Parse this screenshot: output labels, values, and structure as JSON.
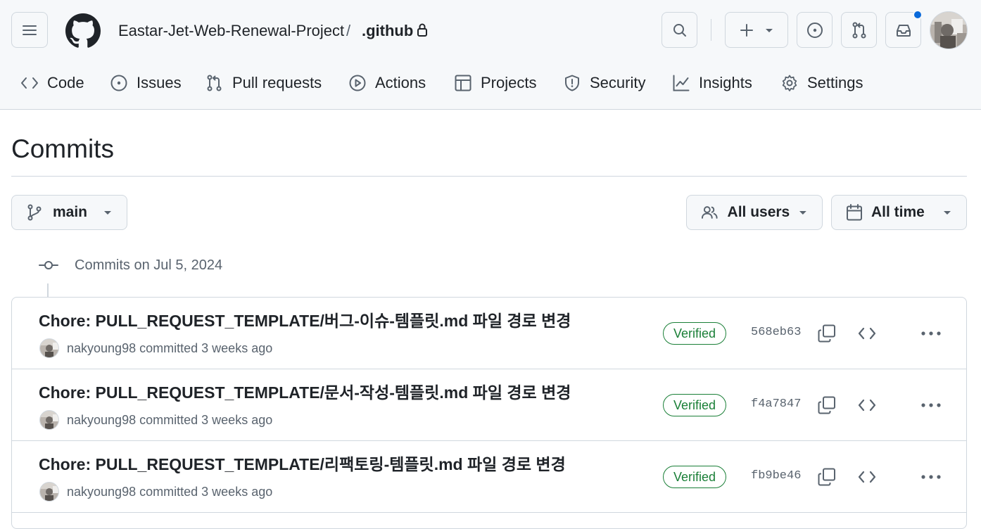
{
  "header": {
    "owner": "Eastar-Jet-Web-Renewal-Project",
    "separator": "/",
    "repo": ".github"
  },
  "repo_nav": [
    {
      "label": "Code",
      "icon": "code-icon"
    },
    {
      "label": "Issues",
      "icon": "issue-opened-icon"
    },
    {
      "label": "Pull requests",
      "icon": "git-pull-request-icon"
    },
    {
      "label": "Actions",
      "icon": "play-icon"
    },
    {
      "label": "Projects",
      "icon": "table-icon"
    },
    {
      "label": "Security",
      "icon": "shield-icon"
    },
    {
      "label": "Insights",
      "icon": "graph-icon"
    },
    {
      "label": "Settings",
      "icon": "gear-icon"
    }
  ],
  "page": {
    "title": "Commits",
    "branch": "main",
    "users_filter": "All users",
    "time_filter": "All time",
    "group_label": "Commits on Jul 5, 2024"
  },
  "commits": [
    {
      "message": "Chore: PULL_REQUEST_TEMPLATE/버그-이슈-템플릿.md 파일 경로 변경",
      "author": "nakyoung98",
      "action": "committed",
      "time": "3 weeks ago",
      "verified": "Verified",
      "sha": "568eb63"
    },
    {
      "message": "Chore: PULL_REQUEST_TEMPLATE/문서-작성-템플릿.md 파일 경로 변경",
      "author": "nakyoung98",
      "action": "committed",
      "time": "3 weeks ago",
      "verified": "Verified",
      "sha": "f4a7847"
    },
    {
      "message": "Chore: PULL_REQUEST_TEMPLATE/리팩토링-템플릿.md 파일 경로 변경",
      "author": "nakyoung98",
      "action": "committed",
      "time": "3 weeks ago",
      "verified": "Verified",
      "sha": "fb9be46"
    }
  ],
  "colors": {
    "accent": "#0969da",
    "verified": "#1a7f37",
    "muted": "#59636e",
    "border": "#d0d7de"
  }
}
